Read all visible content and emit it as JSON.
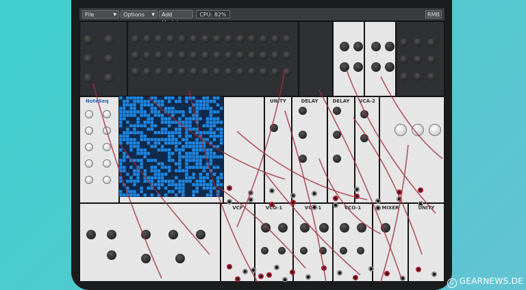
{
  "menubar": {
    "file_label": "File",
    "options_label": "Options",
    "add_module_label": "Add Module",
    "cpu_label": "CPU: 82%",
    "rmb_label": "RMB"
  },
  "modules": {
    "unity": "UNITY",
    "delay1": "DELAY",
    "delay2": "DELAY",
    "vca2": "VCA-2",
    "vco1a": "VCO-1",
    "vco1b": "VCO-1",
    "vco1c": "VCO-1",
    "mixer": "MIXER",
    "unity2": "UNITY",
    "vcf": "VCF",
    "notes": "NoteSeq"
  },
  "watermark": {
    "text": "GEARNEWS.DE"
  },
  "colors": {
    "background": "#4ccbd0",
    "tablet": "#1b1c1e",
    "cable": "#a0303c",
    "seq_blue": "#1e88e5"
  }
}
